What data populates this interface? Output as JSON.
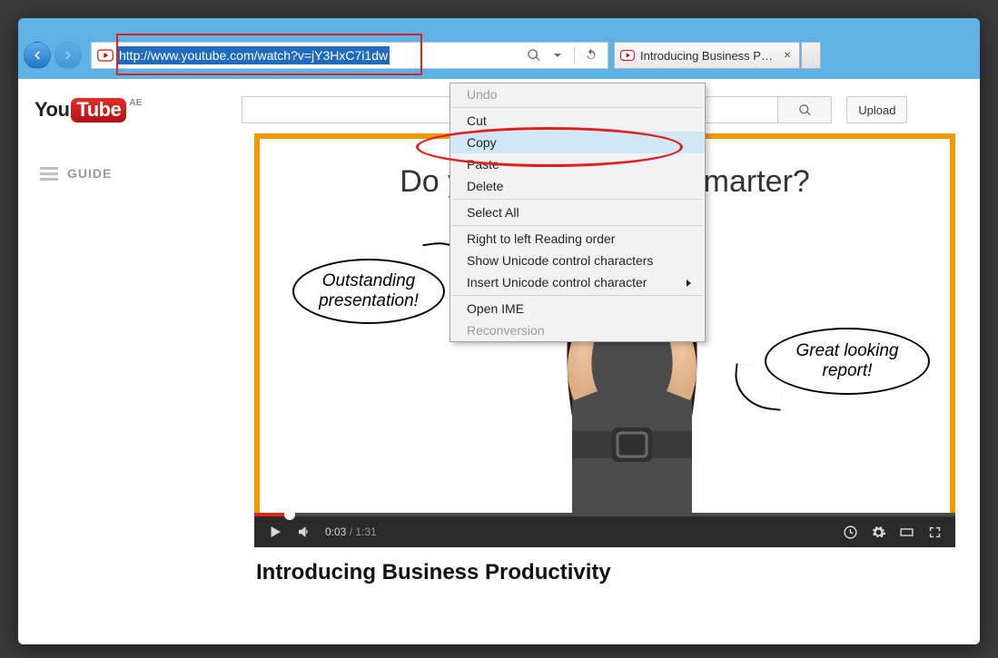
{
  "browser": {
    "address_url": "http://www.youtube.com/watch?v=jY3HxC7i1dw",
    "tab_title": "Introducing Business Produ…"
  },
  "context_menu": {
    "undo": "Undo",
    "cut": "Cut",
    "copy": "Copy",
    "paste": "Paste",
    "delete": "Delete",
    "select_all": "Select All",
    "rtl": "Right to left Reading order",
    "show_unicode": "Show Unicode control characters",
    "insert_unicode": "Insert Unicode control character",
    "open_ime": "Open IME",
    "reconversion": "Reconversion"
  },
  "youtube": {
    "logo_you": "You",
    "logo_tube": "Tube",
    "region": "AE",
    "search_placeholder": "",
    "upload": "Upload",
    "guide": "GUIDE"
  },
  "video": {
    "headline": "Do you want to work smarter?",
    "bubble_left": "Outstanding presentation!",
    "bubble_right": "Great looking report!",
    "time_current": "0:03",
    "time_total": "1:31",
    "title": "Introducing Business Productivity"
  }
}
